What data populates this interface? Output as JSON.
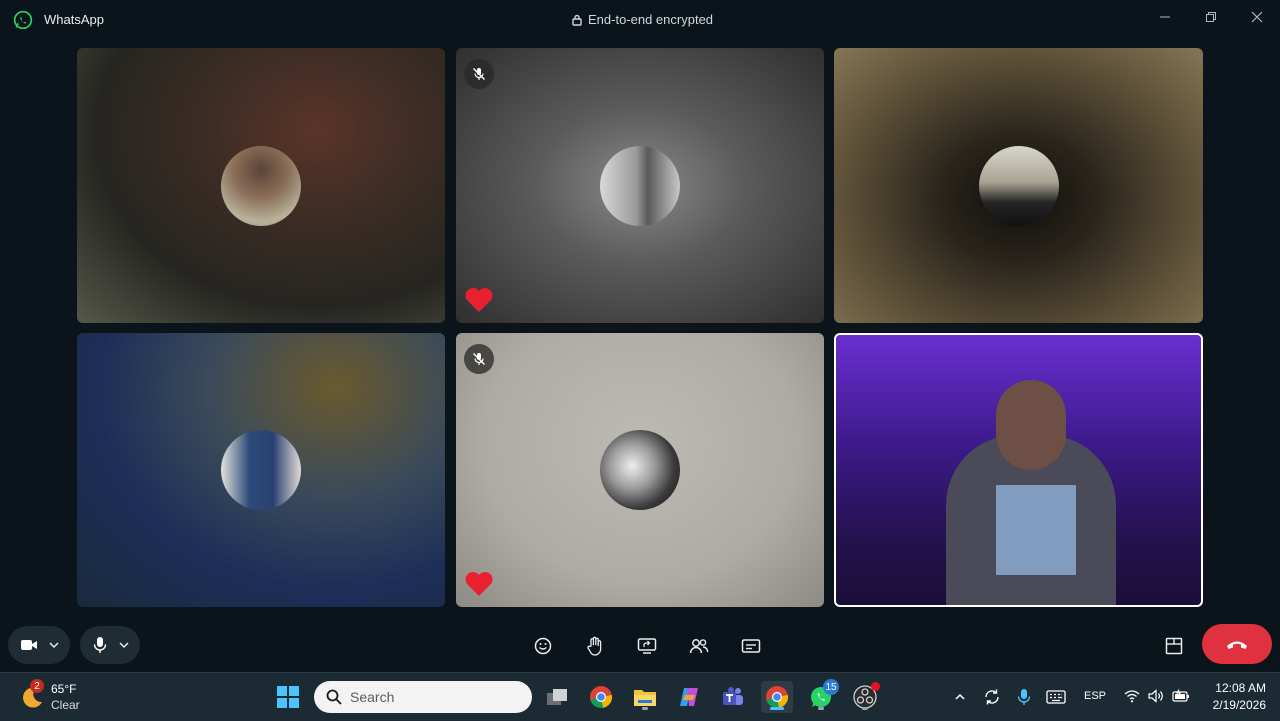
{
  "window": {
    "app_name": "WhatsApp",
    "encryption_label": "End-to-end encrypted",
    "minimize_icon": "minimize-icon",
    "restore_icon": "restore-icon",
    "close_icon": "close-icon"
  },
  "call": {
    "participants": [
      {
        "muted": false,
        "reaction": ""
      },
      {
        "muted": true,
        "reaction": "heart"
      },
      {
        "muted": false,
        "reaction": ""
      },
      {
        "muted": false,
        "reaction": ""
      },
      {
        "muted": true,
        "reaction": "heart"
      },
      {
        "muted": false,
        "reaction": "",
        "self_video": true
      }
    ]
  },
  "controls": {
    "left": [
      "camera-icon",
      "chevron-down-icon",
      "microphone-icon",
      "chevron-down-icon"
    ],
    "center": [
      "emoji-icon",
      "raise-hand-icon",
      "share-screen-icon",
      "participants-icon",
      "captions-icon"
    ],
    "right": [
      "layout-icon",
      "end-call-icon"
    ],
    "end_call_color": "#e0313e"
  },
  "taskbar": {
    "weather_badge": "2",
    "weather_temp": "65°F",
    "weather_desc": "Clear",
    "search_placeholder": "Search",
    "whatsapp_badge": "15",
    "language": "ESP",
    "time": "12:08 AM",
    "date": "2/19/2026"
  },
  "colors": {
    "background": "#0b141a",
    "taskbar": "#1c2a33",
    "accent": "#25d366"
  }
}
